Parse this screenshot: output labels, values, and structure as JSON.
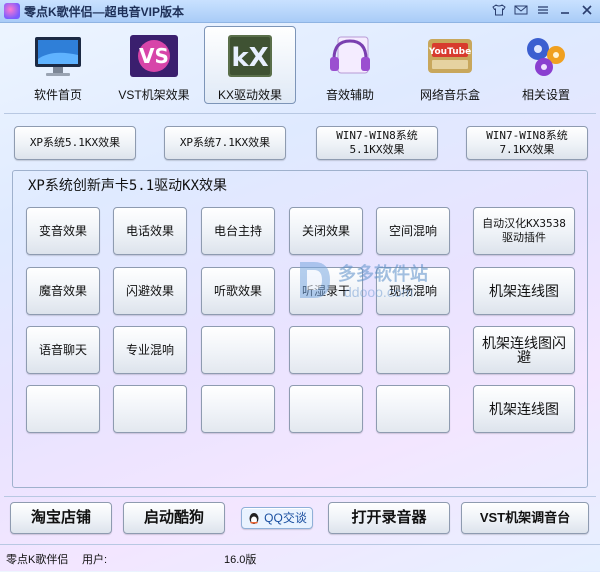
{
  "window": {
    "title": "零点K歌伴侣—超电音VIP版本",
    "controls": [
      "shirt-icon",
      "mail-icon",
      "menu-icon",
      "minimize-icon",
      "close-icon"
    ]
  },
  "toolbar": {
    "items": [
      {
        "label": "软件首页",
        "icon": "monitor-icon",
        "active": false
      },
      {
        "label": "VST机架效果",
        "icon": "vst-icon",
        "active": false
      },
      {
        "label": "KX驱动效果",
        "icon": "kx-icon",
        "active": true
      },
      {
        "label": "音效辅助",
        "icon": "headphones-icon",
        "active": false
      },
      {
        "label": "网络音乐盒",
        "icon": "youtube-icon",
        "active": false
      },
      {
        "label": "相关设置",
        "icon": "gears-icon",
        "active": false
      }
    ]
  },
  "tabs": [
    "XP系统5.1KX效果",
    "XP系统7.1KX效果",
    "WIN7-WIN8系统 5.1KX效果",
    "WIN7-WIN8系统 7.1KX效果"
  ],
  "group": {
    "title": "XP系统创新声卡5.1驱动KX效果",
    "grid": [
      [
        "变音效果",
        "电话效果",
        "电台主持",
        "关闭效果",
        "空间混响"
      ],
      [
        "魔音效果",
        "闪避效果",
        "听歌效果",
        "听湿录干",
        "现场混响"
      ],
      [
        "语音聊天",
        "专业混响",
        "",
        "",
        ""
      ],
      [
        "",
        "",
        "",
        "",
        ""
      ]
    ],
    "side": [
      "自动汉化KX3538驱动插件",
      "机架连线图",
      "机架连线图闪避",
      "机架连线图"
    ]
  },
  "watermark": {
    "line1": "多多软件站",
    "line2": "ddooo.com"
  },
  "bottom": {
    "taobao": "淘宝店铺",
    "kugou": "启动酷狗",
    "qq": "QQ交谈",
    "recorder": "打开录音器",
    "vst": "VST机架调音台"
  },
  "status": {
    "app": "零点K歌伴侣",
    "user_label": "用户:",
    "version": "16.0版"
  }
}
